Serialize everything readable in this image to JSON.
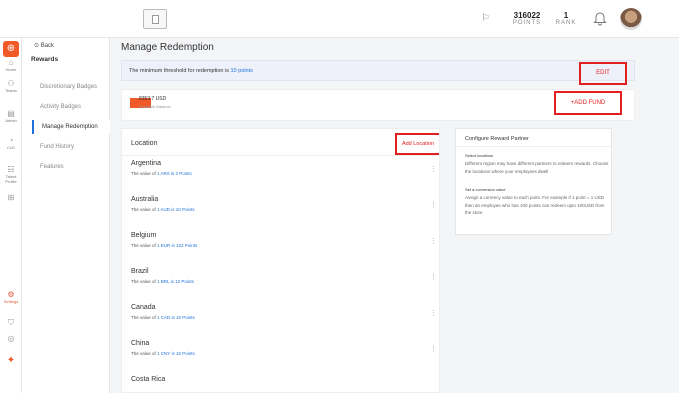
{
  "topbar": {
    "points_value": "316022",
    "points_label": "POINTS",
    "rank_value": "1",
    "rank_label": "RANK"
  },
  "rail": {
    "items": [
      {
        "label": "Home",
        "icon": "home-icon"
      },
      {
        "label": "Teams",
        "icon": "teams-icon"
      },
      {
        "label": "Admin",
        "icon": "admin-icon"
      },
      {
        "label": "CxO",
        "icon": "cxo-icon"
      },
      {
        "label": "...",
        "icon": "more-icon"
      },
      {
        "label": "Talent Profile",
        "icon": "talent-profile-icon"
      },
      {
        "label": "",
        "icon": "grid-icon"
      },
      {
        "label": "Settings",
        "icon": "settings-icon"
      },
      {
        "label": "",
        "icon": "shield-icon"
      },
      {
        "label": "",
        "icon": "help-icon"
      }
    ]
  },
  "sidebar": {
    "back_label": "Back",
    "section_title": "Rewards",
    "items": [
      {
        "label": "Discretionary Badges"
      },
      {
        "label": "Activity Badges"
      },
      {
        "label": "Manage Redemption"
      },
      {
        "label": "Fund History"
      },
      {
        "label": "Features"
      }
    ]
  },
  "main": {
    "title": "Manage Redemption",
    "threshold_prefix": "The minimum threshold for redemption is",
    "threshold_value": "10 points",
    "edit_label": "EDIT",
    "balance_amount": "8353.7 USD",
    "balance_label": "Available Balance",
    "add_fund_label": "+ADD FUND"
  },
  "locations": {
    "title": "Location",
    "add_label": "Add Location",
    "rows": [
      {
        "name": "Argentina",
        "prefix": "The value of",
        "value": "1 ARS is 2 Points"
      },
      {
        "name": "Australia",
        "prefix": "The value of",
        "value": "1 AUD is 10 Points"
      },
      {
        "name": "Belgium",
        "prefix": "The value of",
        "value": "1 EUR is 122 Points"
      },
      {
        "name": "Brazil",
        "prefix": "The value of",
        "value": "1 BRL is 12 Points"
      },
      {
        "name": "Canada",
        "prefix": "The value of",
        "value": "1 CAD is 10 Points"
      },
      {
        "name": "China",
        "prefix": "The value of",
        "value": "1 CNY is 10 Points"
      },
      {
        "name": "Costa Rica",
        "prefix": "",
        "value": ""
      }
    ]
  },
  "configure": {
    "title": "Configure Reward Partner",
    "h1": "Select locations",
    "p1": "Different region may have different partners to redeem rewards. Choose the locations where your employees dwell",
    "h2": "Set a conversion value",
    "p2": "Assign a currency value to each point. For example if 1 point = 1 USD then an employee who has 100 points can redeem upto 100USD from the store"
  },
  "colors": {
    "accent": "#1e6fd9",
    "brand": "#f05a28",
    "highlight_box": "#e02020"
  }
}
